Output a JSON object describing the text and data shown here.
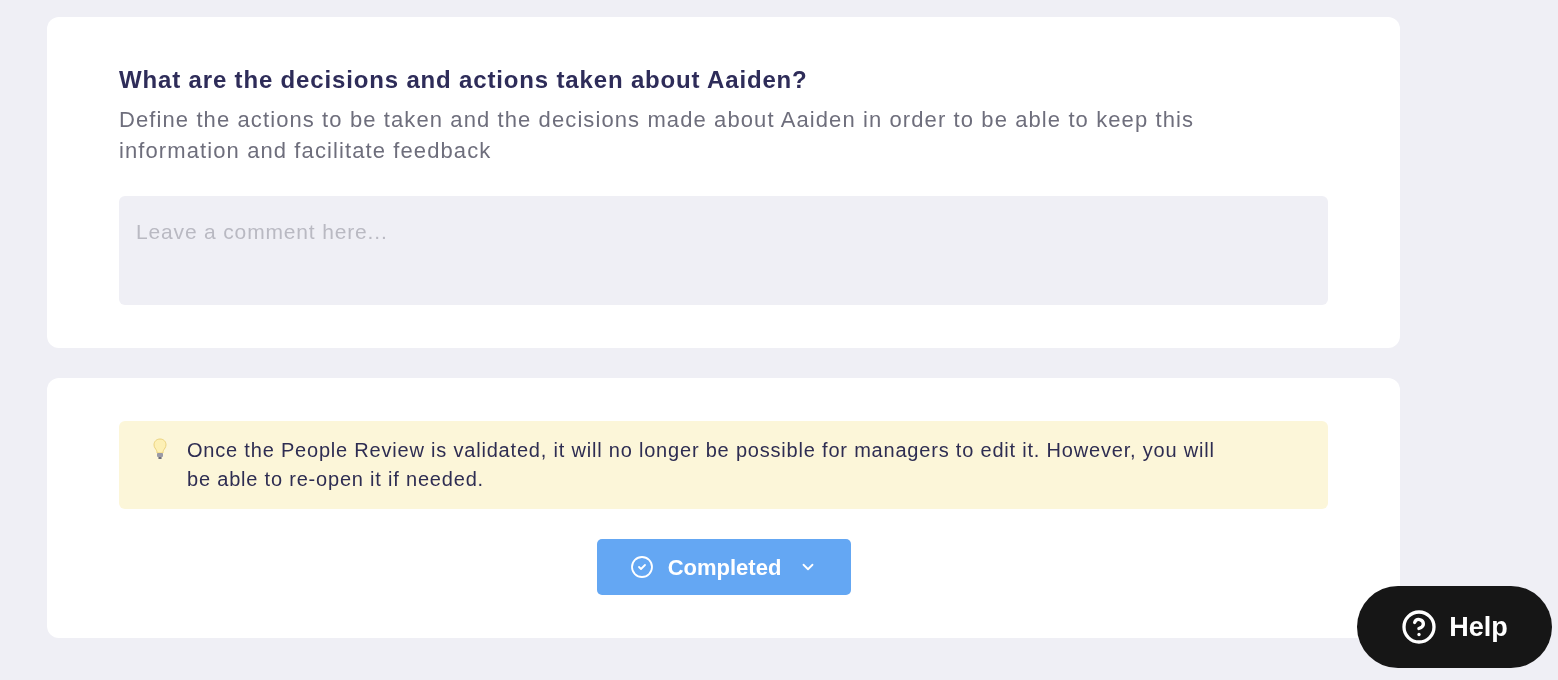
{
  "question_card": {
    "title": "What are the decisions and actions taken about Aaiden?",
    "description": "Define the actions to be taken and the decisions made about Aaiden in order to be able to keep this information and facilitate feedback",
    "comment_field": {
      "placeholder": "Leave a comment here..."
    }
  },
  "validation_card": {
    "notice": "Once the People Review is validated, it will no longer be possible for managers to edit it. However, you will be able to re-open it if needed.",
    "status_button": {
      "label": "Completed"
    }
  },
  "help_button": {
    "label": "Help"
  }
}
